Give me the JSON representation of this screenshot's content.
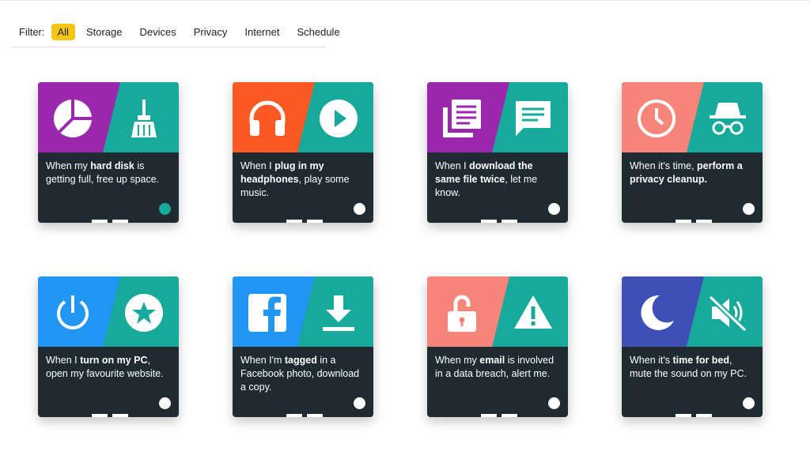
{
  "filter": {
    "label": "Filter:",
    "options": [
      "All",
      "Storage",
      "Devices",
      "Privacy",
      "Internet",
      "Schedule"
    ],
    "selected": "All"
  },
  "colors": {
    "purple": "#9b27af",
    "teal": "#17a99a",
    "orange": "#fc5a24",
    "salmon": "#f7857a",
    "blue": "#2196f3",
    "indigo": "#3d50b6",
    "dark": "#1f2a31",
    "accent": "#f7c614"
  },
  "cards": [
    {
      "icons": [
        "pie-chart-icon",
        "broom-icon"
      ],
      "left": "purple",
      "right": "teal",
      "parts": [
        [
          "When my ",
          false
        ],
        [
          "hard disk",
          true
        ],
        [
          " is getting full, free up space.",
          false
        ]
      ],
      "active": true
    },
    {
      "icons": [
        "headphones-icon",
        "play-icon"
      ],
      "left": "orange",
      "right": "teal",
      "parts": [
        [
          "When I ",
          false
        ],
        [
          "plug in my headphones",
          true
        ],
        [
          ", play some music.",
          false
        ]
      ],
      "active": false
    },
    {
      "icons": [
        "document-copies-icon",
        "message-icon"
      ],
      "left": "purple",
      "right": "teal",
      "parts": [
        [
          "When I ",
          false
        ],
        [
          "download the same file twice",
          true
        ],
        [
          ", let me know.",
          false
        ]
      ],
      "active": false
    },
    {
      "icons": [
        "clock-icon",
        "incognito-icon"
      ],
      "left": "salmon",
      "right": "teal",
      "parts": [
        [
          "When it's time, ",
          false
        ],
        [
          "perform a privacy cleanup.",
          true
        ]
      ],
      "active": false
    },
    {
      "icons": [
        "power-icon",
        "star-icon"
      ],
      "left": "blue",
      "right": "teal",
      "parts": [
        [
          "When I ",
          false
        ],
        [
          "turn on my PC",
          true
        ],
        [
          ", open my favourite website.",
          false
        ]
      ],
      "active": false
    },
    {
      "icons": [
        "facebook-icon",
        "download-icon"
      ],
      "left": "blue",
      "right": "teal",
      "parts": [
        [
          "When I'm ",
          false
        ],
        [
          "tagged",
          true
        ],
        [
          " in a Facebook photo, download a copy.",
          false
        ]
      ],
      "active": false
    },
    {
      "icons": [
        "unlocked-padlock-icon",
        "warning-icon"
      ],
      "left": "salmon",
      "right": "teal",
      "parts": [
        [
          "When my ",
          false
        ],
        [
          "email",
          true
        ],
        [
          " is involved in a data breach, alert me.",
          false
        ]
      ],
      "active": false
    },
    {
      "icons": [
        "moon-icon",
        "mute-icon"
      ],
      "left": "indigo",
      "right": "teal",
      "parts": [
        [
          "When it's ",
          false
        ],
        [
          "time for bed",
          true
        ],
        [
          ", mute the sound on my PC.",
          false
        ]
      ],
      "active": false
    }
  ]
}
